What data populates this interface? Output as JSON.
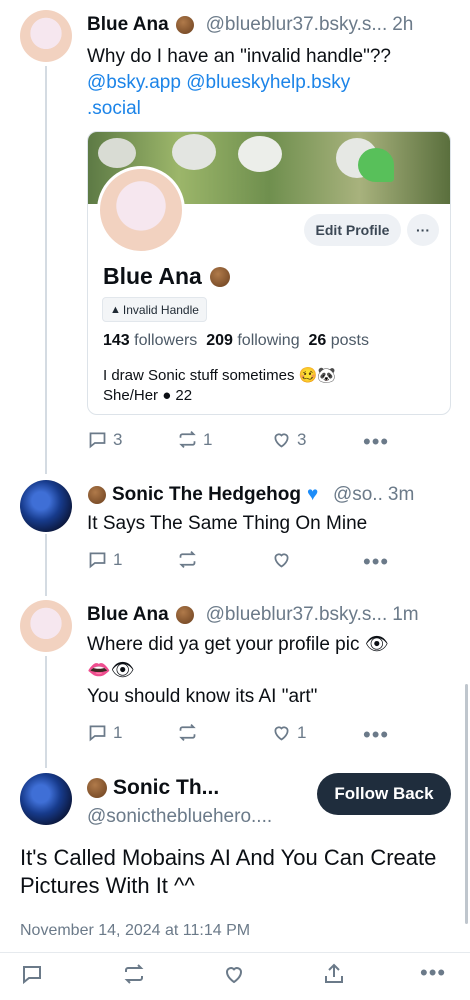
{
  "posts": [
    {
      "author": "Blue Ana",
      "handle": "@blueblur37.bsky.s...",
      "time": "2h",
      "text": "Why do I have an \"invalid handle\"??",
      "mentions": [
        "@bsky.app",
        "@blueskyhelp.bsky",
        ".social"
      ],
      "replies": "3",
      "reposts": "1",
      "likes": "3"
    },
    {
      "author": "Sonic The Hedgehog",
      "handle": "@so..",
      "time": "3m",
      "text": "It Says The Same Thing On Mine",
      "replies": "1",
      "reposts": "",
      "likes": ""
    },
    {
      "author": "Blue Ana",
      "handle": "@blueblur37.bsky.s...",
      "time": "1m",
      "text_line1": "Where did ya get your profile pic 👁",
      "text_line2": "👄👁",
      "text_line3": "You should know its AI \"art\"",
      "replies": "1",
      "reposts": "",
      "likes": "1"
    }
  ],
  "profile_card": {
    "edit_label": "Edit Profile",
    "more_label": "···",
    "name": "Blue Ana",
    "badge": "Invalid Handle",
    "badge_icon": "warning-icon",
    "followers_count": "143",
    "followers_label": "followers",
    "following_count": "209",
    "following_label": "following",
    "posts_count": "26",
    "posts_label": "posts",
    "bio_line1": "I draw Sonic stuff sometimes 🥴🐼",
    "bio_line2": "She/Her ● 22"
  },
  "focused": {
    "author": "Sonic Th...",
    "handle": "@sonicthebluehero....",
    "follow_label": "Follow Back",
    "text": "It's Called Mobains AI And You Can Create Pictures With It ^^",
    "timestamp": "November 14, 2024 at 11:14 PM"
  },
  "more_label": "•••",
  "colors": {
    "link": "#1c84e8",
    "muted": "#6b7a89",
    "follow_button": "#1f2d3d",
    "verified_heart": "#1d8cf8"
  }
}
